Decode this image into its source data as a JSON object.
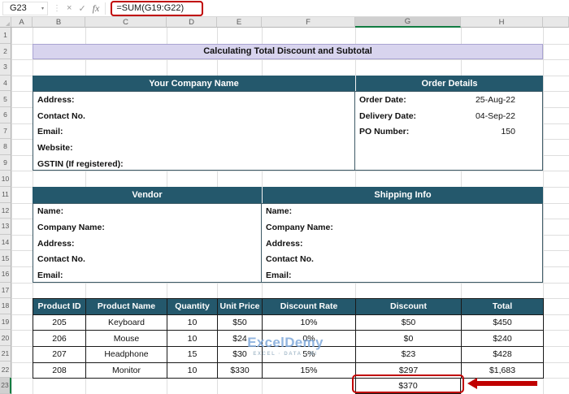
{
  "formula_bar": {
    "name_box": "G23",
    "name_box_dropdown_icon": "▾",
    "menu_dots_icon": "⋮",
    "cancel_icon": "×",
    "enter_icon": "✓",
    "fx_icon": "fx",
    "formula": "=SUM(G19:G22)"
  },
  "sheet": {
    "column_labels": [
      "A",
      "B",
      "C",
      "D",
      "E",
      "F",
      "G",
      "H"
    ],
    "selected_column": "G",
    "row_labels": [
      "1",
      "2",
      "3",
      "4",
      "5",
      "6",
      "7",
      "8",
      "9",
      "10",
      "11",
      "12",
      "13",
      "14",
      "15",
      "16",
      "17",
      "18",
      "19",
      "20",
      "21",
      "22",
      "23"
    ],
    "selected_row": "23"
  },
  "title": "Calculating Total Discount and Subtotal",
  "company": {
    "header": "Your Company Name",
    "fields": [
      "Address:",
      "Contact No.",
      "Email:",
      "Website:",
      "GSTIN (If registered):"
    ]
  },
  "order_details": {
    "header": "Order Details",
    "items": [
      {
        "label": "Order Date:",
        "value": "25-Aug-22"
      },
      {
        "label": "Delivery Date:",
        "value": "04-Sep-22"
      },
      {
        "label": "PO Number:",
        "value": "150"
      }
    ]
  },
  "vendor": {
    "header": "Vendor",
    "fields": [
      "Name:",
      "Company Name:",
      "Address:",
      "Contact No.",
      "Email:"
    ]
  },
  "shipping": {
    "header": "Shipping Info",
    "fields": [
      "Name:",
      "Company Name:",
      "Address:",
      "Contact No.",
      "Email:"
    ]
  },
  "product_table": {
    "headers": [
      "Product ID",
      "Product Name",
      "Quantity",
      "Unit Price",
      "Discount Rate",
      "Discount",
      "Total"
    ],
    "rows": [
      [
        "205",
        "Keyboard",
        "10",
        "$50",
        "10%",
        "$50",
        "$450"
      ],
      [
        "206",
        "Mouse",
        "10",
        "$24",
        "0%",
        "$0",
        "$240"
      ],
      [
        "207",
        "Headphone",
        "15",
        "$30",
        "5%",
        "$23",
        "$428"
      ],
      [
        "208",
        "Monitor",
        "10",
        "$330",
        "15%",
        "$297",
        "$1,683"
      ]
    ]
  },
  "total_discount": {
    "cell": "G23",
    "value": "$370"
  },
  "watermark": {
    "brand": "ExcelDemy",
    "tagline": "EXCEL · DATA · BI"
  },
  "colors": {
    "section_header_bg": "#24586C",
    "title_bg": "#D8D4EE",
    "annotation_red": "#C00000"
  }
}
